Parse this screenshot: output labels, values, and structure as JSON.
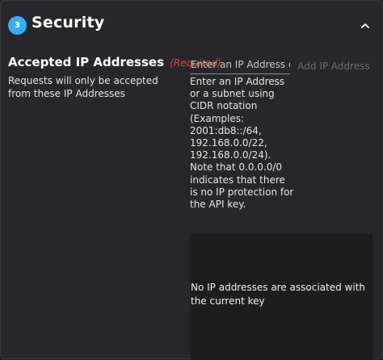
{
  "section": {
    "step_number": "3",
    "title": "Security",
    "collapse_icon": "chevron-up-icon",
    "accent_color": "#38aef0"
  },
  "field": {
    "label": "Accepted IP Addresses",
    "required_tag": "(Required)",
    "required_color": "#e0463c",
    "description": "Requests will only be accepted from these IP Addresses"
  },
  "ip_input": {
    "placeholder": "Enter an IP Address or",
    "value": ""
  },
  "add_button": {
    "label": "Add IP Address",
    "enabled": false
  },
  "hint": "Enter an IP Address or a subnet using CIDR notation (Examples: 2001:db8::/64, 192.168.0.0/22, 192.168.0.0/24). Note that 0.0.0.0/0 indicates that there is no IP protection for the API key.",
  "ip_list": {
    "items": [],
    "empty_message": "No IP addresses are associated with the current key"
  }
}
